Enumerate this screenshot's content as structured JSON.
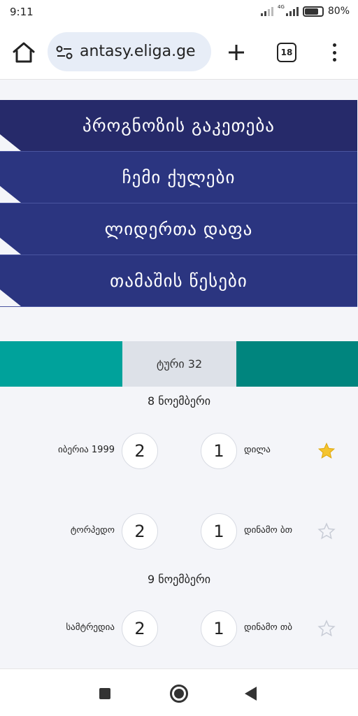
{
  "status": {
    "time": "9:11",
    "network": "4G",
    "battery": "80%"
  },
  "browser": {
    "url_faded": "",
    "url_visible": "antasy.eliga.ge",
    "tab_count": "18"
  },
  "nav": {
    "items": [
      {
        "label": "პროგნოზის გაკეთება"
      },
      {
        "label": "ჩემი ქულები"
      },
      {
        "label": "ლიდერთა დაფა"
      },
      {
        "label": "თამაშის წესები"
      }
    ]
  },
  "round": {
    "current": "ტური 32"
  },
  "matches": {
    "day1": {
      "date": "8 ნოემბერი",
      "games": [
        {
          "home": "იბერია 1999",
          "home_score": "2",
          "away_score": "1",
          "away": "დილა",
          "favorite": true
        },
        {
          "home": "ტორპედო",
          "home_score": "2",
          "away_score": "1",
          "away": "დინამო ბთ",
          "favorite": false
        }
      ]
    },
    "day2": {
      "date": "9 ნოემბერი",
      "games": [
        {
          "home": "სამტრედია",
          "home_score": "2",
          "away_score": "1",
          "away": "დინამო თბ",
          "favorite": false
        }
      ]
    }
  },
  "colors": {
    "nav_dark": "#262a6a",
    "nav": "#2b3580",
    "teal": "#00a29b",
    "teal_dark": "#00857e",
    "star_filled": "#f4c430",
    "star_outline": "#c8ccd6"
  }
}
